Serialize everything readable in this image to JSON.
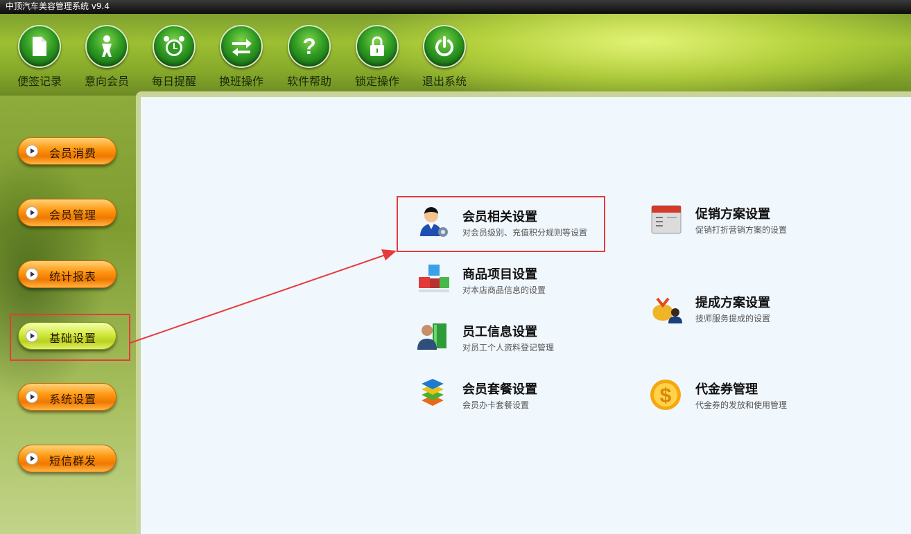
{
  "window": {
    "title": "中顶汽车美容管理系统 v9.4"
  },
  "toolbar": {
    "items": [
      {
        "label": "便签记录",
        "icon": "note-icon"
      },
      {
        "label": "意向会员",
        "icon": "person-icon"
      },
      {
        "label": "每日提醒",
        "icon": "alarm-clock-icon"
      },
      {
        "label": "换班操作",
        "icon": "swap-arrows-icon"
      },
      {
        "label": "软件帮助",
        "icon": "question-icon"
      },
      {
        "label": "锁定操作",
        "icon": "lock-icon"
      },
      {
        "label": "退出系统",
        "icon": "power-icon"
      }
    ]
  },
  "sidebar": {
    "items": [
      {
        "label": "会员消费",
        "active": false
      },
      {
        "label": "会员管理",
        "active": false
      },
      {
        "label": "统计报表",
        "active": false
      },
      {
        "label": "基础设置",
        "active": true
      },
      {
        "label": "系统设置",
        "active": false
      },
      {
        "label": "短信群发",
        "active": false
      }
    ]
  },
  "main": {
    "settings": [
      {
        "title": "会员相关设置",
        "desc": "对会员级别、充值积分规则等设置",
        "icon": "member-settings-icon",
        "highlighted": true
      },
      {
        "title": "商品项目设置",
        "desc": "对本店商品信息的设置",
        "icon": "cubes-icon"
      },
      {
        "title": "员工信息设置",
        "desc": "对员工个人资料登记管理",
        "icon": "employee-icon"
      },
      {
        "title": "会员套餐设置",
        "desc": "会员办卡套餐设置",
        "icon": "layers-icon"
      },
      {
        "title": "促销方案设置",
        "desc": "促销打折营销方案的设置",
        "icon": "calendar-icon"
      },
      {
        "title": "提成方案设置",
        "desc": "技师服务提成的设置",
        "icon": "commission-icon"
      },
      {
        "title": "代金券管理",
        "desc": "代金券的发放和使用管理",
        "icon": "dollar-coin-icon"
      }
    ]
  },
  "colors": {
    "highlight": "#e83a3a",
    "panel_bg": "#f0f7fd",
    "nav_button": "#ff9a14",
    "nav_button_active": "#d6ec4a"
  }
}
